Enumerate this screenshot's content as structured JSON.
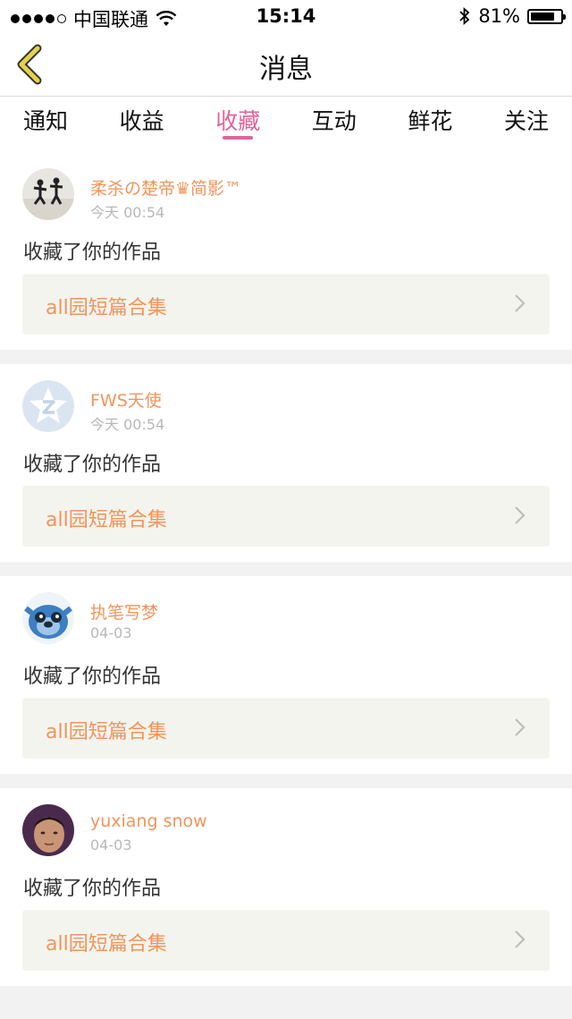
{
  "status_bar": {
    "carrier": "中国联通",
    "time": "15:14",
    "battery_text": "81%",
    "battery_level": 0.81,
    "signal_bars_filled": 4,
    "signal_bars_total": 5
  },
  "nav": {
    "title": "消息",
    "back_icon": "chevron-left-icon"
  },
  "tabs": [
    {
      "label": "通知",
      "active": false
    },
    {
      "label": "收益",
      "active": false
    },
    {
      "label": "收藏",
      "active": true
    },
    {
      "label": "互动",
      "active": false
    },
    {
      "label": "鲜花",
      "active": false
    },
    {
      "label": "关注",
      "active": false
    }
  ],
  "feed": [
    {
      "user": "柔杀の楚帝♛简影™",
      "time": "今天 00:54",
      "action": "收藏了你的作品",
      "work": "all园短篇合集",
      "avatar": "avatar-photo-silhouettes"
    },
    {
      "user": "FWS天使",
      "time": "今天 00:54",
      "action": "收藏了你的作品",
      "work": "all园短篇合集",
      "avatar": "avatar-default-qq"
    },
    {
      "user": "执笔写梦",
      "time": "04-03",
      "action": "收藏了你的作品",
      "work": "all园短篇合集",
      "avatar": "avatar-stitch-cartoon"
    },
    {
      "user": "yuxiang snow",
      "time": "04-03",
      "action": "收藏了你的作品",
      "work": "all园短篇合集",
      "avatar": "avatar-photo-face"
    }
  ],
  "colors": {
    "accent_pink": "#e2649a",
    "name_orange": "#f0955c",
    "back_arrow_yellow": "#e6d24a",
    "card_bg": "#f4f4ee"
  }
}
